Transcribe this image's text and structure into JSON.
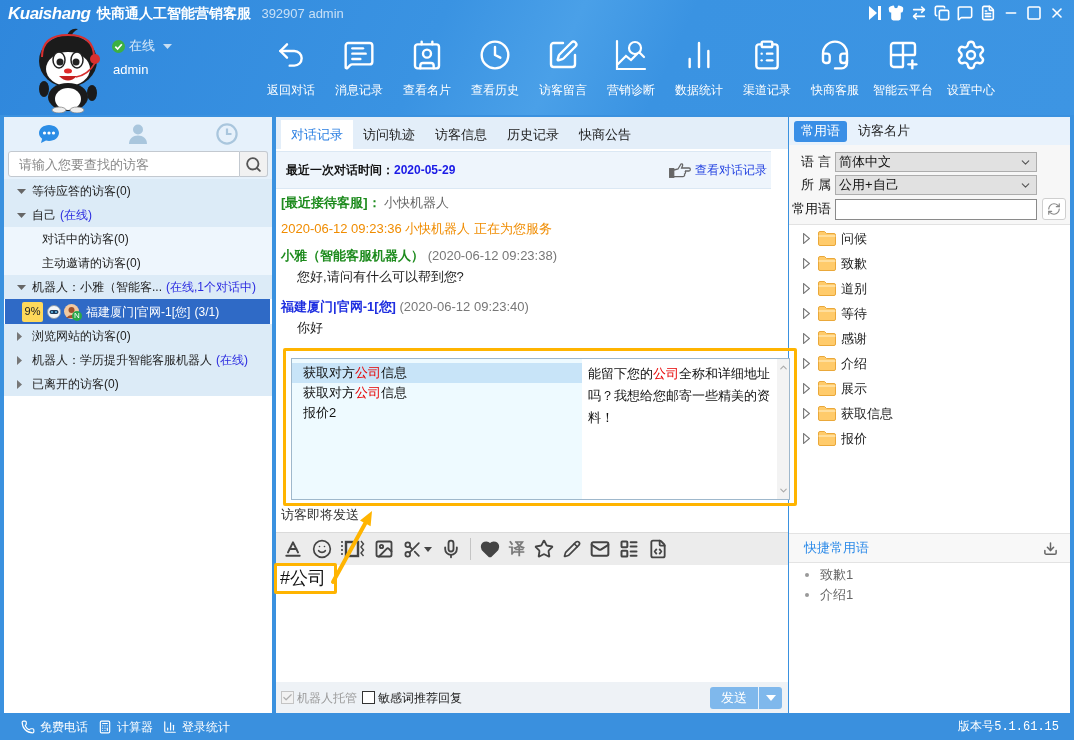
{
  "window": {
    "logo": "Kuaishang",
    "title": "快商通人工智能营销客服",
    "account": "392907 admin"
  },
  "user": {
    "status": "在线",
    "name": "admin"
  },
  "toolbar": [
    "返回对话",
    "消息记录",
    "查看名片",
    "查看历史",
    "访客留言",
    "营销诊断",
    "数据统计",
    "渠道记录",
    "快商客服",
    "智能云平台",
    "设置中心"
  ],
  "visitor_tabs": [
    {
      "selected": true
    },
    {
      "selected": false
    },
    {
      "selected": false
    }
  ],
  "visitor_search": {
    "placeholder": "请输入您要查找的访客"
  },
  "visitor_tree": [
    {
      "label": "等待应答的访客(0)",
      "expanded": true
    },
    {
      "label": "自己",
      "status": "(在线)",
      "expanded": true,
      "children": [
        {
          "kind": "group",
          "label": "对话中的访客(0)",
          "selected": false
        },
        {
          "kind": "group",
          "label": "主动邀请的访客(0)",
          "selected": false
        }
      ]
    },
    {
      "label": "机器人：小雅（智能客...",
      "status": "(在线,1个对话中)",
      "expanded": true,
      "children": [
        {
          "kind": "visitor",
          "badge": "9%",
          "new_mark": "N",
          "label": "福建厦门|官网-1[您]",
          "count": "(3/1)",
          "selected": true
        }
      ]
    },
    {
      "label": "浏览网站的访客(0)",
      "expanded": false
    },
    {
      "label": "机器人：学历提升智能客服机器人",
      "status": "(在线)",
      "expanded": false
    },
    {
      "label": "已离开的访客(0)",
      "expanded": false
    }
  ],
  "chat_tabs": [
    {
      "label": "对话记录",
      "selected": true
    },
    {
      "label": "访问轨迹",
      "selected": false
    },
    {
      "label": "访客信息",
      "selected": false
    },
    {
      "label": "历史记录",
      "selected": false
    },
    {
      "label": "快商公告",
      "selected": false
    }
  ],
  "last_chat": {
    "label": "最近一次对话时间：",
    "date": "2020-05-29",
    "link": "查看对话记录"
  },
  "chat_log": [
    {
      "kind": "note",
      "label": "[最近接待客服]：",
      "text": "小快机器人"
    },
    {
      "kind": "system",
      "text": "2020-06-12 09:23:36 小快机器人 正在为您服务"
    },
    {
      "kind": "robot",
      "sender": "小雅（智能客服机器人）",
      "time": "(2020-06-12 09:23:38)",
      "text": "您好,请问有什么可以帮到您?"
    },
    {
      "kind": "visitor",
      "sender": "福建厦门|官网-1[您]",
      "time": "(2020-06-12 09:23:40)",
      "text": "你好"
    }
  ],
  "suggestions": {
    "items": [
      {
        "selected": true,
        "prefix": "获取对方",
        "match": "公司",
        "suffix": "信息"
      },
      {
        "selected": false,
        "prefix": "获取对方",
        "match": "公司",
        "suffix": "信息"
      },
      {
        "selected": false,
        "prefix": "报价2"
      }
    ],
    "preview": {
      "prefix": "能留下您的",
      "match": "公司",
      "suffix": "全称和详细地址吗？我想给您邮寄一些精美的资料！"
    }
  },
  "typing_status": "访客即将发送",
  "composer_tools": {
    "translate": "译"
  },
  "composer": {
    "value": "#公司"
  },
  "options": [
    {
      "label": "机器人托管",
      "checked": true,
      "disabled": true
    },
    {
      "label": "敏感词推荐回复",
      "checked": false,
      "disabled": false
    }
  ],
  "send_button": {
    "label": "发送"
  },
  "phrase_tabs": [
    {
      "label": "常用语",
      "selected": true
    },
    {
      "label": "访客名片",
      "selected": false
    }
  ],
  "phrase_filters": [
    {
      "kind": "select",
      "label": "语 言",
      "value": "简体中文"
    },
    {
      "kind": "select",
      "label": "所 属",
      "value": "公用+自己"
    },
    {
      "kind": "input",
      "label": "常用语"
    }
  ],
  "phrase_folders": [
    {
      "label": "问候",
      "expanded": false
    },
    {
      "label": "致歉",
      "expanded": false
    },
    {
      "label": "道别",
      "expanded": false
    },
    {
      "label": "等待",
      "expanded": false
    },
    {
      "label": "感谢",
      "expanded": false
    },
    {
      "label": "介绍",
      "expanded": false
    },
    {
      "label": "展示",
      "expanded": false
    },
    {
      "label": "获取信息",
      "expanded": false
    },
    {
      "label": "报价",
      "expanded": false
    }
  ],
  "quick_phrases": {
    "title": "快捷常用语",
    "items": [
      "致歉1",
      "介绍1"
    ]
  },
  "status_bar": {
    "items": [
      "免费电话",
      "计算器",
      "登录统计"
    ],
    "version": "版本号5.1.61.15"
  }
}
